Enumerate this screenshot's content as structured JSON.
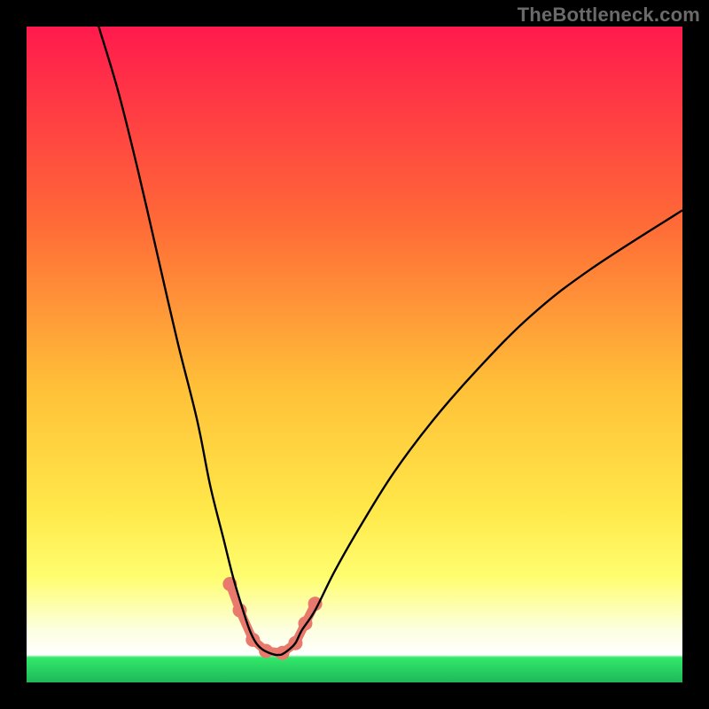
{
  "watermark": "TheBottleneck.com",
  "colors": {
    "bg": "#000000",
    "grad_top": "#ff1a4d",
    "grad_mid1": "#ff8d2b",
    "grad_mid2": "#ffe03a",
    "grad_mid3": "#ffff66",
    "grad_low": "#faffd0",
    "grad_green": "#32e86a",
    "curve": "#000000",
    "link": "#E8796C"
  },
  "chart_data": {
    "type": "line",
    "title": "",
    "xlabel": "",
    "ylabel": "",
    "xlim": [
      0,
      100
    ],
    "ylim": [
      0,
      100
    ],
    "series": [
      {
        "name": "bottleneck-curve-left",
        "x": [
          11,
          14,
          17,
          20,
          23,
          26,
          28,
          30,
          31.5,
          33,
          34,
          35,
          36,
          37,
          38,
          38.5
        ],
        "values": [
          100,
          90,
          78,
          65,
          52,
          40,
          30,
          22,
          16,
          11,
          8,
          6,
          5,
          4.5,
          4.2,
          4.2
        ]
      },
      {
        "name": "bottleneck-curve-right",
        "x": [
          38.5,
          39,
          40,
          41,
          42,
          44,
          47,
          51,
          56,
          62,
          69,
          77,
          86,
          100
        ],
        "values": [
          4.2,
          4.3,
          5,
          6,
          8,
          11,
          17,
          24,
          32,
          40,
          48,
          56,
          63,
          72
        ]
      },
      {
        "name": "salmon-links",
        "x": [
          31,
          32.5,
          34.5,
          36.5,
          39,
          41,
          42.5,
          44
        ],
        "values": [
          15,
          11,
          6.5,
          4.8,
          4.5,
          6,
          9,
          12
        ]
      }
    ],
    "annotations": []
  }
}
